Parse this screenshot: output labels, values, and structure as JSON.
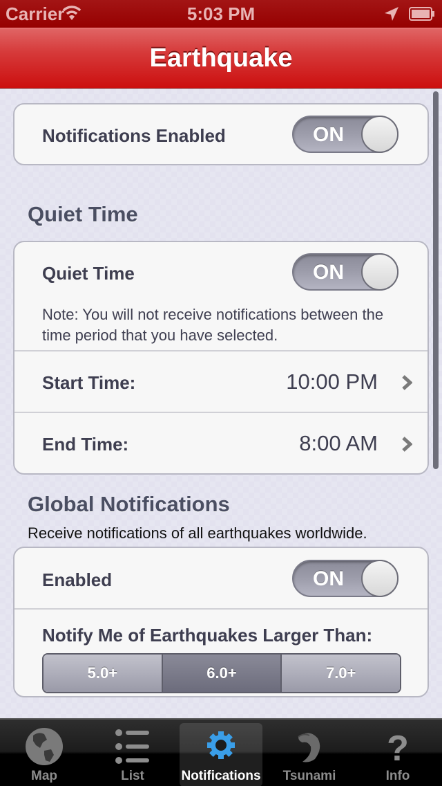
{
  "status_bar": {
    "carrier": "Carrier",
    "time": "5:03 PM",
    "icons": [
      "wifi-icon",
      "location-arrow-icon",
      "battery-icon"
    ]
  },
  "nav": {
    "title": "Earthquake",
    "colors": {
      "bar": "#cc0f0f"
    }
  },
  "notifications_enabled": {
    "label": "Notifications Enabled",
    "switch": "ON",
    "on": true
  },
  "quiet_time": {
    "section_title": "Quiet Time",
    "toggle_label": "Quiet Time",
    "switch": "ON",
    "on": true,
    "note": "Note: You will not receive notifications between the time period that you have selected.",
    "start": {
      "label": "Start Time:",
      "value": "10:00 PM"
    },
    "end": {
      "label": "End Time:",
      "value": "8:00 AM"
    }
  },
  "global": {
    "section_title": "Global Notifications",
    "subtitle": "Receive notifications of all earthquakes worldwide.",
    "enabled_label": "Enabled",
    "switch": "ON",
    "on": true,
    "threshold_label": "Notify Me of Earthquakes Larger Than:",
    "segments": [
      "5.0+",
      "6.0+",
      "7.0+"
    ],
    "selected_segment": "6.0+"
  },
  "tab_bar": {
    "tabs": [
      {
        "label": "Map",
        "icon": "globe-icon",
        "active": false
      },
      {
        "label": "List",
        "icon": "list-icon",
        "active": false
      },
      {
        "label": "Notifications",
        "icon": "gear-icon",
        "active": true
      },
      {
        "label": "Tsunami",
        "icon": "wave-icon",
        "active": false
      },
      {
        "label": "Info",
        "icon": "question-icon",
        "active": false
      }
    ],
    "colors": {
      "active_icon": "#3a9ee8"
    }
  }
}
